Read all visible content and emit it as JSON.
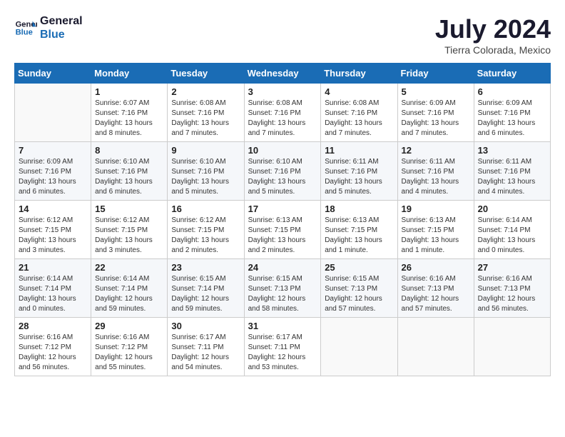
{
  "logo": {
    "line1": "General",
    "line2": "Blue"
  },
  "title": "July 2024",
  "location": "Tierra Colorada, Mexico",
  "days_header": [
    "Sunday",
    "Monday",
    "Tuesday",
    "Wednesday",
    "Thursday",
    "Friday",
    "Saturday"
  ],
  "weeks": [
    [
      {
        "day": "",
        "sunrise": "",
        "sunset": "",
        "daylight": ""
      },
      {
        "day": "1",
        "sunrise": "Sunrise: 6:07 AM",
        "sunset": "Sunset: 7:16 PM",
        "daylight": "Daylight: 13 hours and 8 minutes."
      },
      {
        "day": "2",
        "sunrise": "Sunrise: 6:08 AM",
        "sunset": "Sunset: 7:16 PM",
        "daylight": "Daylight: 13 hours and 7 minutes."
      },
      {
        "day": "3",
        "sunrise": "Sunrise: 6:08 AM",
        "sunset": "Sunset: 7:16 PM",
        "daylight": "Daylight: 13 hours and 7 minutes."
      },
      {
        "day": "4",
        "sunrise": "Sunrise: 6:08 AM",
        "sunset": "Sunset: 7:16 PM",
        "daylight": "Daylight: 13 hours and 7 minutes."
      },
      {
        "day": "5",
        "sunrise": "Sunrise: 6:09 AM",
        "sunset": "Sunset: 7:16 PM",
        "daylight": "Daylight: 13 hours and 7 minutes."
      },
      {
        "day": "6",
        "sunrise": "Sunrise: 6:09 AM",
        "sunset": "Sunset: 7:16 PM",
        "daylight": "Daylight: 13 hours and 6 minutes."
      }
    ],
    [
      {
        "day": "7",
        "sunrise": "Sunrise: 6:09 AM",
        "sunset": "Sunset: 7:16 PM",
        "daylight": "Daylight: 13 hours and 6 minutes."
      },
      {
        "day": "8",
        "sunrise": "Sunrise: 6:10 AM",
        "sunset": "Sunset: 7:16 PM",
        "daylight": "Daylight: 13 hours and 6 minutes."
      },
      {
        "day": "9",
        "sunrise": "Sunrise: 6:10 AM",
        "sunset": "Sunset: 7:16 PM",
        "daylight": "Daylight: 13 hours and 5 minutes."
      },
      {
        "day": "10",
        "sunrise": "Sunrise: 6:10 AM",
        "sunset": "Sunset: 7:16 PM",
        "daylight": "Daylight: 13 hours and 5 minutes."
      },
      {
        "day": "11",
        "sunrise": "Sunrise: 6:11 AM",
        "sunset": "Sunset: 7:16 PM",
        "daylight": "Daylight: 13 hours and 5 minutes."
      },
      {
        "day": "12",
        "sunrise": "Sunrise: 6:11 AM",
        "sunset": "Sunset: 7:16 PM",
        "daylight": "Daylight: 13 hours and 4 minutes."
      },
      {
        "day": "13",
        "sunrise": "Sunrise: 6:11 AM",
        "sunset": "Sunset: 7:16 PM",
        "daylight": "Daylight: 13 hours and 4 minutes."
      }
    ],
    [
      {
        "day": "14",
        "sunrise": "Sunrise: 6:12 AM",
        "sunset": "Sunset: 7:15 PM",
        "daylight": "Daylight: 13 hours and 3 minutes."
      },
      {
        "day": "15",
        "sunrise": "Sunrise: 6:12 AM",
        "sunset": "Sunset: 7:15 PM",
        "daylight": "Daylight: 13 hours and 3 minutes."
      },
      {
        "day": "16",
        "sunrise": "Sunrise: 6:12 AM",
        "sunset": "Sunset: 7:15 PM",
        "daylight": "Daylight: 13 hours and 2 minutes."
      },
      {
        "day": "17",
        "sunrise": "Sunrise: 6:13 AM",
        "sunset": "Sunset: 7:15 PM",
        "daylight": "Daylight: 13 hours and 2 minutes."
      },
      {
        "day": "18",
        "sunrise": "Sunrise: 6:13 AM",
        "sunset": "Sunset: 7:15 PM",
        "daylight": "Daylight: 13 hours and 1 minute."
      },
      {
        "day": "19",
        "sunrise": "Sunrise: 6:13 AM",
        "sunset": "Sunset: 7:15 PM",
        "daylight": "Daylight: 13 hours and 1 minute."
      },
      {
        "day": "20",
        "sunrise": "Sunrise: 6:14 AM",
        "sunset": "Sunset: 7:14 PM",
        "daylight": "Daylight: 13 hours and 0 minutes."
      }
    ],
    [
      {
        "day": "21",
        "sunrise": "Sunrise: 6:14 AM",
        "sunset": "Sunset: 7:14 PM",
        "daylight": "Daylight: 13 hours and 0 minutes."
      },
      {
        "day": "22",
        "sunrise": "Sunrise: 6:14 AM",
        "sunset": "Sunset: 7:14 PM",
        "daylight": "Daylight: 12 hours and 59 minutes."
      },
      {
        "day": "23",
        "sunrise": "Sunrise: 6:15 AM",
        "sunset": "Sunset: 7:14 PM",
        "daylight": "Daylight: 12 hours and 59 minutes."
      },
      {
        "day": "24",
        "sunrise": "Sunrise: 6:15 AM",
        "sunset": "Sunset: 7:13 PM",
        "daylight": "Daylight: 12 hours and 58 minutes."
      },
      {
        "day": "25",
        "sunrise": "Sunrise: 6:15 AM",
        "sunset": "Sunset: 7:13 PM",
        "daylight": "Daylight: 12 hours and 57 minutes."
      },
      {
        "day": "26",
        "sunrise": "Sunrise: 6:16 AM",
        "sunset": "Sunset: 7:13 PM",
        "daylight": "Daylight: 12 hours and 57 minutes."
      },
      {
        "day": "27",
        "sunrise": "Sunrise: 6:16 AM",
        "sunset": "Sunset: 7:13 PM",
        "daylight": "Daylight: 12 hours and 56 minutes."
      }
    ],
    [
      {
        "day": "28",
        "sunrise": "Sunrise: 6:16 AM",
        "sunset": "Sunset: 7:12 PM",
        "daylight": "Daylight: 12 hours and 56 minutes."
      },
      {
        "day": "29",
        "sunrise": "Sunrise: 6:16 AM",
        "sunset": "Sunset: 7:12 PM",
        "daylight": "Daylight: 12 hours and 55 minutes."
      },
      {
        "day": "30",
        "sunrise": "Sunrise: 6:17 AM",
        "sunset": "Sunset: 7:11 PM",
        "daylight": "Daylight: 12 hours and 54 minutes."
      },
      {
        "day": "31",
        "sunrise": "Sunrise: 6:17 AM",
        "sunset": "Sunset: 7:11 PM",
        "daylight": "Daylight: 12 hours and 53 minutes."
      },
      {
        "day": "",
        "sunrise": "",
        "sunset": "",
        "daylight": ""
      },
      {
        "day": "",
        "sunrise": "",
        "sunset": "",
        "daylight": ""
      },
      {
        "day": "",
        "sunrise": "",
        "sunset": "",
        "daylight": ""
      }
    ]
  ]
}
